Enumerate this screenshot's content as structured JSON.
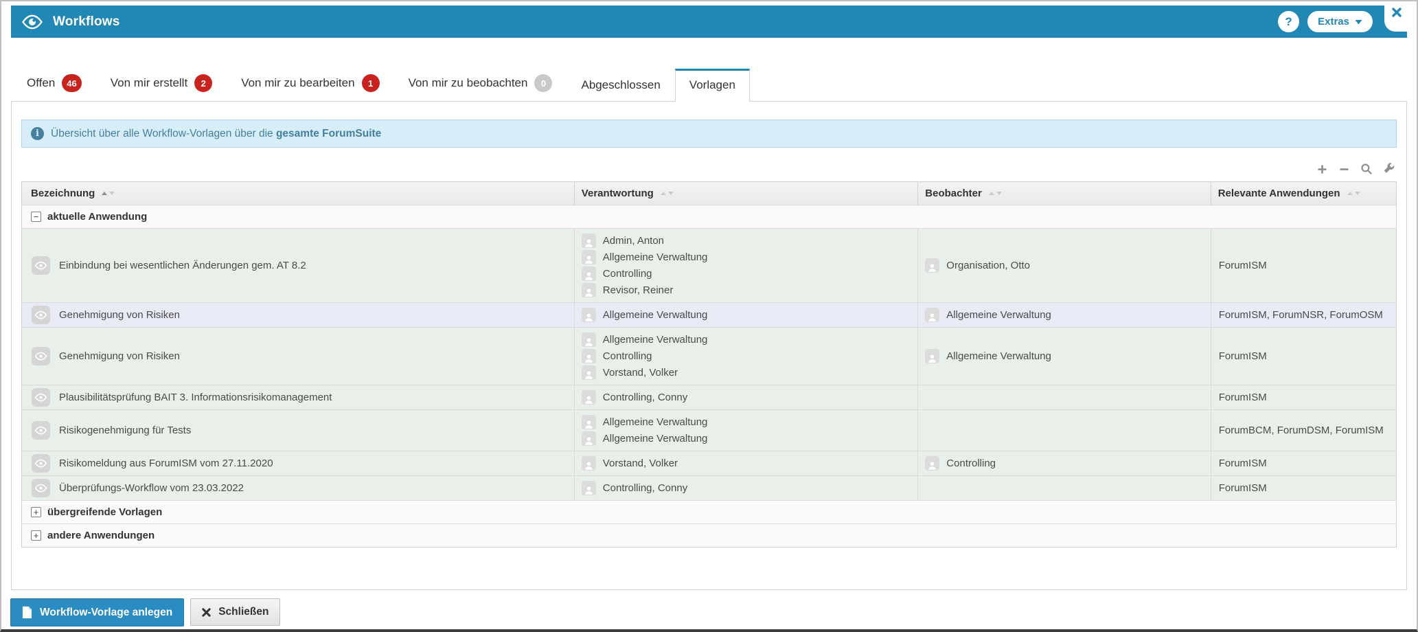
{
  "header": {
    "title": "Workflows",
    "help_label": "?",
    "extras_label": "Extras"
  },
  "tabs": [
    {
      "label": "Offen",
      "badge": "46",
      "badge_style": "red",
      "active": false
    },
    {
      "label": "Von mir erstellt",
      "badge": "2",
      "badge_style": "red",
      "active": false
    },
    {
      "label": "Von mir zu bearbeiten",
      "badge": "1",
      "badge_style": "red",
      "active": false
    },
    {
      "label": "Von mir zu beobachten",
      "badge": "0",
      "badge_style": "gray",
      "active": false
    },
    {
      "label": "Abgeschlossen",
      "badge": null,
      "active": false
    },
    {
      "label": "Vorlagen",
      "badge": null,
      "active": true
    }
  ],
  "info_bar": {
    "prefix": "Übersicht über alle Workflow-Vorlagen über die ",
    "bold": "gesamte ForumSuite"
  },
  "toolbar": {
    "icons": [
      "expand-all",
      "collapse-all",
      "search",
      "settings"
    ]
  },
  "table": {
    "columns": [
      {
        "label": "Bezeichnung",
        "sort": "asc"
      },
      {
        "label": "Verantwortung",
        "sort": "none"
      },
      {
        "label": "Beobachter",
        "sort": "none"
      },
      {
        "label": "Relevante Anwendungen",
        "sort": "none"
      }
    ],
    "groups": [
      {
        "label": "aktuelle Anwendung",
        "state": "expanded",
        "rows": [
          {
            "name": "Einbindung bei wesentlichen Änderungen gem. AT 8.2",
            "responsible": [
              "Admin, Anton",
              "Allgemeine Verwaltung",
              "Controlling",
              "Revisor, Reiner"
            ],
            "observers": [
              "Organisation, Otto"
            ],
            "apps": "ForumISM",
            "highlighted": false
          },
          {
            "name": "Genehmigung von Risiken",
            "responsible": [
              "Allgemeine Verwaltung"
            ],
            "observers": [
              "Allgemeine Verwaltung"
            ],
            "apps": "ForumISM, ForumNSR, ForumOSM",
            "highlighted": true
          },
          {
            "name": "Genehmigung von Risiken",
            "responsible": [
              "Allgemeine Verwaltung",
              "Controlling",
              "Vorstand, Volker"
            ],
            "observers": [
              "Allgemeine Verwaltung"
            ],
            "apps": "ForumISM",
            "highlighted": false
          },
          {
            "name": "Plausibilitätsprüfung BAIT 3. Informationsrisikomanagement",
            "responsible": [
              "Controlling, Conny"
            ],
            "observers": [],
            "apps": "ForumISM",
            "highlighted": false
          },
          {
            "name": "Risikogenehmigung für Tests",
            "responsible": [
              "Allgemeine Verwaltung",
              "Allgemeine Verwaltung"
            ],
            "observers": [],
            "apps": "ForumBCM, ForumDSM, ForumISM",
            "highlighted": false
          },
          {
            "name": "Risikomeldung aus ForumISM vom 27.11.2020",
            "responsible": [
              "Vorstand, Volker"
            ],
            "observers": [
              "Controlling"
            ],
            "apps": "ForumISM",
            "highlighted": false
          },
          {
            "name": "Überprüfungs-Workflow vom 23.03.2022",
            "responsible": [
              "Controlling, Conny"
            ],
            "observers": [],
            "apps": "ForumISM",
            "highlighted": false
          }
        ]
      },
      {
        "label": "übergreifende Vorlagen",
        "state": "collapsed",
        "rows": []
      },
      {
        "label": "andere Anwendungen",
        "state": "collapsed",
        "rows": []
      }
    ]
  },
  "footer": {
    "create_label": "Workflow-Vorlage anlegen",
    "close_label": "Schließen"
  },
  "colors": {
    "accent": "#2187b4",
    "badge_red": "#c9211e",
    "badge_gray": "#c9c9c9",
    "row_green": "#e9f0e9",
    "row_highlight": "#e8eaf5",
    "info_bg": "#d7edf8",
    "info_text": "#44809d",
    "button_blue": "#2b8cc1"
  }
}
